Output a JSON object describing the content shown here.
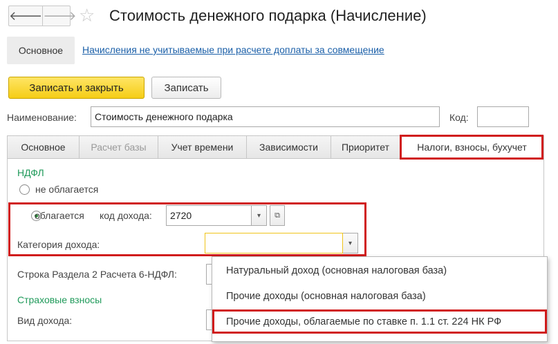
{
  "nav": {
    "back_icon": "arrow-left-icon",
    "forward_icon": "arrow-right-icon",
    "back_glyph": "🡐",
    "forward_glyph": "🡒",
    "star_glyph": "☆"
  },
  "window": {
    "title": "Стоимость денежного подарка (Начисление)"
  },
  "sections": {
    "main_tab": "Основное",
    "link": "Начисления не учитываемые при расчете доплаты за совмещение"
  },
  "toolbar": {
    "save_close": "Записать и закрыть",
    "save": "Записать"
  },
  "form": {
    "name_label": "Наименование:",
    "name_value": "Стоимость денежного подарка",
    "code_label": "Код:",
    "code_value": ""
  },
  "tabs": [
    {
      "label": "Основное"
    },
    {
      "label": "Расчет базы"
    },
    {
      "label": "Учет времени"
    },
    {
      "label": "Зависимости"
    },
    {
      "label": "Приоритет"
    },
    {
      "label": "Налоги, взносы, бухучет"
    }
  ],
  "ndfl": {
    "heading": "НДФЛ",
    "option_not_taxed": "не облагается",
    "option_taxed": "облагается",
    "income_code_label": "код дохода:",
    "income_code_value": "2720",
    "category_label": "Категория дохода:",
    "category_value": "",
    "report_line_label": "Строка Раздела 2 Расчета 6-НДФЛ:",
    "dropdown_arrow": "▾",
    "open_glyph": "⧉"
  },
  "insurance": {
    "heading": "Страховые взносы",
    "income_type_label": "Вид дохода:"
  },
  "dropdown_options": [
    "Натуральный доход (основная налоговая база)",
    "Прочие доходы (основная налоговая база)",
    "Прочие доходы, облагаемые по ставке п. 1.1 ст. 224 НК РФ"
  ],
  "colors": {
    "highlight_red": "#d01b1b",
    "accent_yellow": "#f5cd16",
    "green_heading": "#1f9a5a",
    "link_blue": "#1a5fa8"
  }
}
